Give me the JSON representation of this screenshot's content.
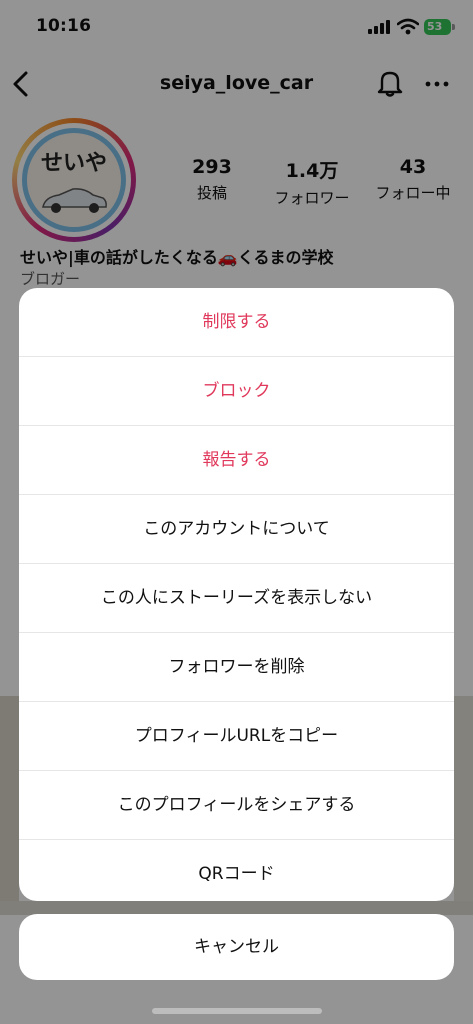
{
  "status_bar": {
    "time": "10:16",
    "battery": "53",
    "battery_color": "#34c759"
  },
  "header": {
    "title": "seiya_love_car",
    "back_icon": "chevron-left-icon",
    "notification_icon": "bell-icon",
    "more_icon": "ellipsis-icon"
  },
  "profile": {
    "avatar_text": "せいや",
    "stats": [
      {
        "value": "293",
        "label": "投稿"
      },
      {
        "value": "1.4万",
        "label": "フォロワー"
      },
      {
        "value": "43",
        "label": "フォロー中"
      }
    ],
    "display_name": "せいや|車の話がしたくなる🚗くるまの学校",
    "category": "ブロガー"
  },
  "action_sheet": {
    "items": [
      {
        "label": "制限する",
        "destructive": true
      },
      {
        "label": "ブロック",
        "destructive": true
      },
      {
        "label": "報告する",
        "destructive": true
      },
      {
        "label": "このアカウントについて",
        "destructive": false
      },
      {
        "label": "この人にストーリーズを表示しない",
        "destructive": false
      },
      {
        "label": "フォロワーを削除",
        "destructive": false
      },
      {
        "label": "プロフィールURLをコピー",
        "destructive": false
      },
      {
        "label": "このプロフィールをシェアする",
        "destructive": false
      },
      {
        "label": "QRコード",
        "destructive": false
      }
    ],
    "cancel_label": "キャンセル",
    "destructive_color": "#e0395c"
  }
}
